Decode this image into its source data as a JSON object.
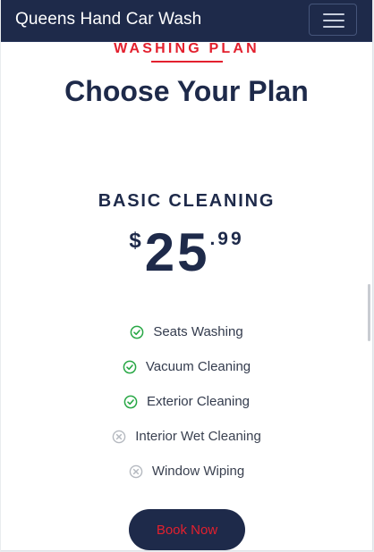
{
  "navbar": {
    "brand": "Queens Hand Car Wash",
    "toggler_icon": "hamburger-icon"
  },
  "section": {
    "eyebrow": "WASHING PLAN",
    "title": "Choose Your Plan"
  },
  "plan": {
    "name": "BASIC CLEANING",
    "price": {
      "currency": "$",
      "integer": "25",
      "decimal": ".99"
    },
    "features": [
      {
        "label": "Seats Washing",
        "included": true,
        "icon": "check-circle-icon"
      },
      {
        "label": "Vacuum Cleaning",
        "included": true,
        "icon": "check-circle-icon"
      },
      {
        "label": "Exterior Cleaning",
        "included": true,
        "icon": "check-circle-icon"
      },
      {
        "label": "Interior Wet Cleaning",
        "included": false,
        "icon": "x-circle-icon"
      },
      {
        "label": "Window Wiping",
        "included": false,
        "icon": "x-circle-icon"
      }
    ],
    "cta": "Book Now"
  },
  "colors": {
    "navy": "#1e2a4a",
    "accent_red": "#e3202e",
    "check_green": "#28a745",
    "muted_gray": "#b5b9c0"
  }
}
